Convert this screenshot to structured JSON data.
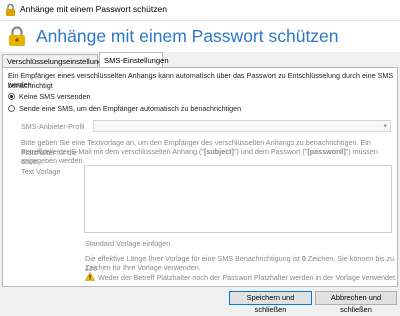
{
  "window": {
    "title": "Anhänge mit einem Passwort schützen"
  },
  "header": {
    "title": "Anhänge mit einem Passwort schützen"
  },
  "tabs": [
    {
      "label": "Verschlüsselungseinstellungen",
      "active": false
    },
    {
      "label": "SMS-Einstellungen",
      "active": true
    }
  ],
  "sms": {
    "intro_line1": "Ein Empfänger eines verschlüsselten Anhangs kann automatisch über das Passwort zu Entschlüsselung durch eine SMS benachrichtigt",
    "intro_line2": "werden.",
    "option_none": "Keine SMS versenden",
    "option_send": "Sende eine SMS, um den Empfänger automatisch zu benachrichtigen",
    "selected_option": "Keine SMS versenden",
    "provider_label": "SMS-Anbieter-Profil",
    "provider_value": "",
    "instructions_line1": "Bitte geben Sie eine Textvorlage an, um den Empfänger des verschlüsselten Anhangs zu benachrichtigen. Ein Platzhalter für die",
    "instructions_line2_a": "Betreffzeile der E-Mail mit dem verschlüsselten Anhang (\"",
    "placeholder_subject": "[subject]",
    "instructions_line2_b": "\") und dem Passwort (\"",
    "placeholder_password": "[password]",
    "instructions_line2_c": "\") müssen dabei",
    "instructions_line3": "angegeben werden.",
    "text_template_label": "Text Vorlage",
    "text_template_value": "",
    "insert_default_link": "Standard Vorlage einfügen",
    "length_line1_a": "Die effektive Länge Ihrer Vorlage für eine SMS Benachrichtigung ist ",
    "length_value": "0",
    "length_line1_b": " Zeichen. Sie können bis zu 120",
    "length_line2": "Zeichen für Ihre Vorlage verwenden.",
    "warning": "Weder der Betreff Platzhalter noch der Passwort Platzhalter werden in der Vorlage verwendet."
  },
  "footer": {
    "save_close": "Speichern und schließen",
    "cancel_close": "Abbrechen und schließen"
  },
  "colors": {
    "accent": "#2b78c8",
    "warning": "#f2c200"
  }
}
